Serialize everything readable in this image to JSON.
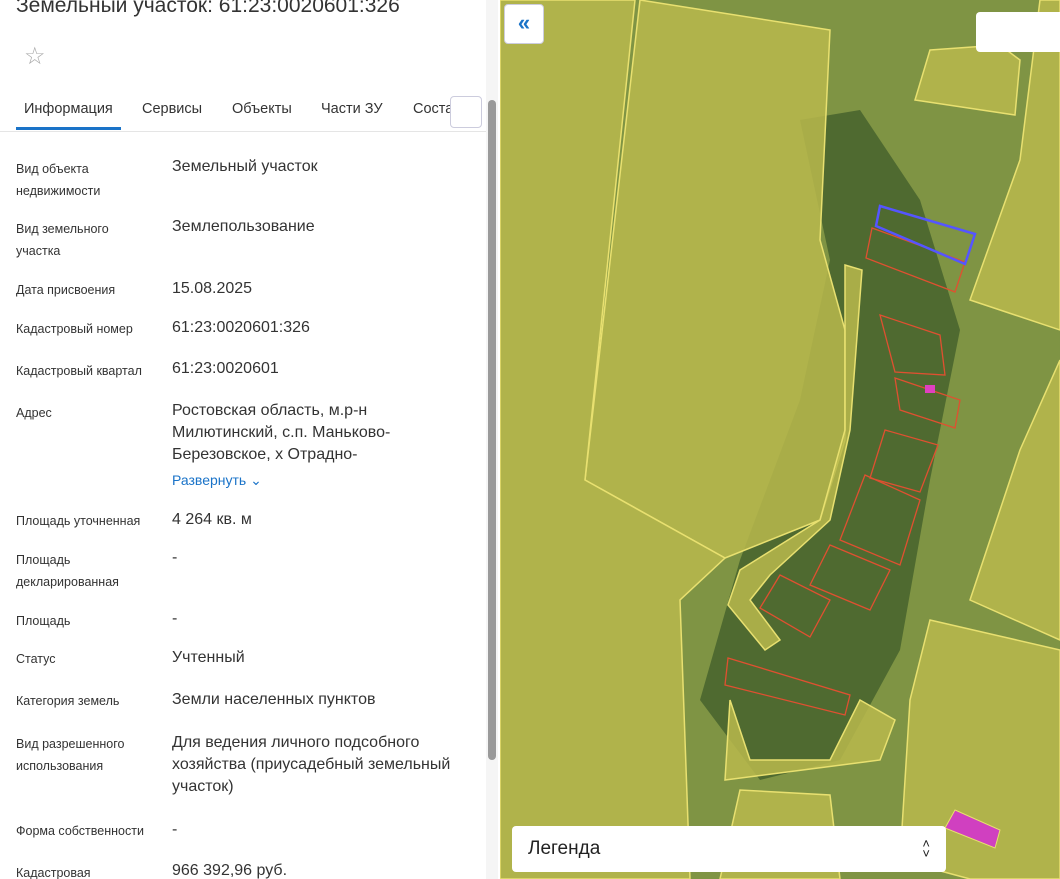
{
  "header": {
    "title": "Земельный участок: 61:23:0020601:326",
    "star_icon": "star-icon"
  },
  "tabs": [
    {
      "label": "Информация",
      "active": true
    },
    {
      "label": "Сервисы"
    },
    {
      "label": "Объекты"
    },
    {
      "label": "Части ЗУ"
    },
    {
      "label": "Соста"
    }
  ],
  "rows": [
    {
      "label": "Вид объекта недвижимости",
      "value": "Земельный участок"
    },
    {
      "label": "Вид земельного участка",
      "value": "Землепользование"
    },
    {
      "label": "Дата присвоения",
      "value": "15.08.2025"
    },
    {
      "label": "Кадастровый номер",
      "value": "61:23:0020601:326"
    },
    {
      "label": "Кадастровый квартал",
      "value": "61:23:0020601"
    },
    {
      "label": "Адрес",
      "value": "Ростовская область, м.р-н Милютинский, с.п. Маньково-Березовское, х Отрадно-"
    },
    {
      "label": "Площадь уточненная",
      "value": "4 264 кв. м"
    },
    {
      "label": "Площадь декларированная",
      "value": "-"
    },
    {
      "label": "Площадь",
      "value": "-"
    },
    {
      "label": "Статус",
      "value": "Учтенный"
    },
    {
      "label": "Категория земель",
      "value": "Земли населенных пунктов"
    },
    {
      "label": "Вид разрешенного использования",
      "value": "Для ведения личного подсобного хозяйства (приусадебный земельный участок)"
    },
    {
      "label": "Форма собственности",
      "value": "-"
    },
    {
      "label": "Кадастровая",
      "value": "966 392,96 руб."
    }
  ],
  "expand_link": "Развернуть",
  "map": {
    "collapse_icon": "«",
    "legend_label": "Легенда",
    "colors": {
      "parcel": "#e8e070",
      "selected": "#5555ff",
      "building": "#e05030",
      "special": "#e040c0"
    }
  }
}
